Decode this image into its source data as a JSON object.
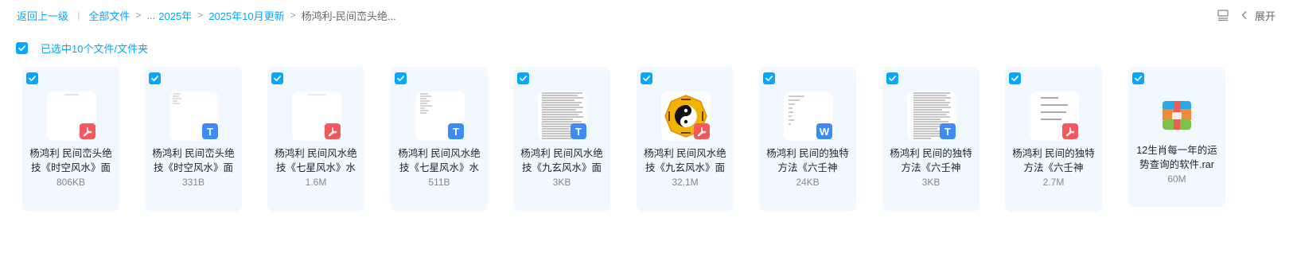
{
  "breadcrumb": {
    "back": "返回上一级",
    "all_files": "全部文件",
    "ellipsis": "...",
    "year": "2025年",
    "month": "2025年10月更新",
    "current": "杨鸿利-民间峦头绝..."
  },
  "toolbar": {
    "expand_label": "展开"
  },
  "selection": {
    "label": "已选中10个文件/文件夹"
  },
  "files": [
    {
      "name": "杨鸿利 民间峦头绝技《时空风水》面",
      "size": "806KB",
      "type": "pdf",
      "icon": "pdf-icon"
    },
    {
      "name": "杨鸿利 民间峦头绝技《时空风水》面",
      "size": "331B",
      "type": "txt",
      "icon": "text-file-icon"
    },
    {
      "name": "杨鸿利 民间风水绝技《七星风水》水",
      "size": "1.6M",
      "type": "pdf",
      "icon": "pdf-icon"
    },
    {
      "name": "杨鸿利 民间风水绝技《七星风水》水",
      "size": "511B",
      "type": "txt",
      "icon": "text-file-icon"
    },
    {
      "name": "杨鸿利 民间风水绝技《九玄风水》面",
      "size": "3KB",
      "type": "txt",
      "icon": "text-file-icon"
    },
    {
      "name": "杨鸿利 民间风水绝技《九玄风水》面",
      "size": "32.1M",
      "type": "pdf",
      "icon": "pdf-icon"
    },
    {
      "name": "杨鸿利 民间的独特方法《六壬神",
      "size": "24KB",
      "type": "doc",
      "icon": "word-icon"
    },
    {
      "name": "杨鸿利 民间的独特方法《六壬神",
      "size": "3KB",
      "type": "txt",
      "icon": "text-file-icon"
    },
    {
      "name": "杨鸿利 民间的独特方法《六壬神",
      "size": "2.7M",
      "type": "pdf",
      "icon": "pdf-icon"
    },
    {
      "name": "12生肖每一年的运势查询的软件.rar",
      "size": "60M",
      "type": "rar",
      "icon": "archive-icon"
    }
  ],
  "colors": {
    "accent": "#06a7ff",
    "card_bg": "#f1f8ff",
    "pdf": "#f5575f",
    "txt": "#3d8cf5"
  }
}
